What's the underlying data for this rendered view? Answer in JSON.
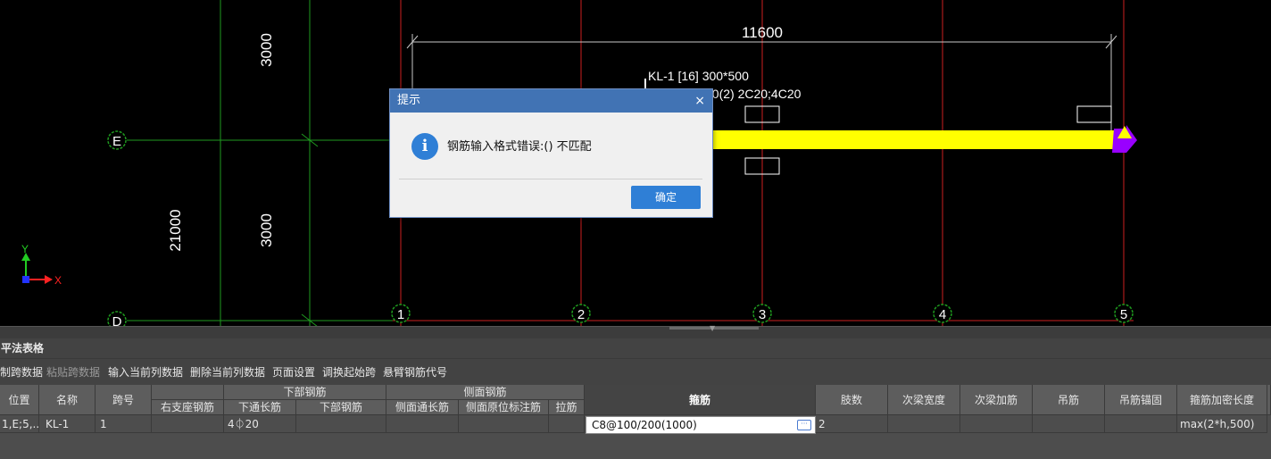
{
  "canvas": {
    "dimension_top": "11600",
    "dimension_left_outer": "21000",
    "dimension_left_upper": "3000",
    "dimension_left_lower": "3000",
    "beam_label_line1": "KL-1 [16] 300*500",
    "beam_label_line2": "00(2) 2C20;4C20",
    "axis_row_labels": [
      "E",
      "D"
    ],
    "axis_col_labels": [
      "1",
      "2",
      "3",
      "4",
      "5"
    ],
    "coord_y_label": "Y",
    "coord_x_label": "X",
    "colors": {
      "beam": "#ffff00",
      "axis_line_red": "#cc1f1f",
      "axis_line_green": "#1f9a1f",
      "bubble": "#1f9a1f",
      "support": "#9900ff"
    }
  },
  "panel": {
    "title": "平法表格",
    "toolbar": [
      {
        "label": "制跨数据",
        "enabled": true
      },
      {
        "label": "粘贴跨数据",
        "enabled": false
      },
      {
        "label": "输入当前列数据",
        "enabled": true
      },
      {
        "label": "删除当前列数据",
        "enabled": true
      },
      {
        "label": "页面设置",
        "enabled": true
      },
      {
        "label": "调换起始跨",
        "enabled": true
      },
      {
        "label": "悬臂钢筋代号",
        "enabled": true
      }
    ],
    "table": {
      "col_headers": [
        "位置",
        "名称",
        "跨号",
        "右支座钢筋",
        "下通长筋",
        "下部钢筋",
        "侧面通长筋",
        "侧面原位标注筋",
        "拉筋",
        "箍筋",
        "肢数",
        "次梁宽度",
        "次梁加筋",
        "吊筋",
        "吊筋锚固",
        "箍筋加密长度"
      ],
      "group_headers": [
        "下部钢筋",
        "侧面钢筋"
      ],
      "row": {
        "position": "1,E;5,...",
        "name": "KL-1",
        "span": "1",
        "right_support": "",
        "bottom_through": "4⏀20",
        "bottom_rebar": "",
        "side_through": "",
        "side_original": "",
        "tie": "",
        "stirrup": "C8@100/200(1000)",
        "legs": "2",
        "sec_beam_width": "",
        "sec_beam_add": "",
        "hanger": "",
        "hanger_anchor": "",
        "stirrup_dense_len": "max(2*h,500)"
      }
    }
  },
  "dialog": {
    "title": "提示",
    "close_glyph": "×",
    "icon_glyph": "i",
    "message": "钢筋输入格式错误:() 不匹配",
    "ok_label": "确定"
  }
}
